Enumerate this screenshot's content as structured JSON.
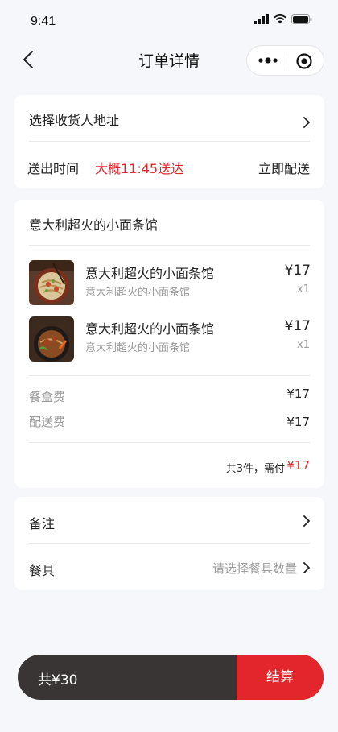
{
  "status_bar": {
    "time": "9:41"
  },
  "nav": {
    "title": "订单详情"
  },
  "address": {
    "select_label": "选择收货人地址",
    "time_label": "送出时间",
    "time_value": "大概11:45送达",
    "delivery_mode": "立即配送"
  },
  "order": {
    "store_name": "意大利超火的小面条馆",
    "items": [
      {
        "name": "意大利超火的小面条馆",
        "desc": "意大利超火的小面条馆",
        "price": "¥17",
        "qty": "x1"
      },
      {
        "name": "意大利超火的小面条馆",
        "desc": "意大利超火的小面条馆",
        "price": "¥17",
        "qty": "x1"
      }
    ],
    "fees": [
      {
        "label": "餐盒费",
        "value": "¥17"
      },
      {
        "label": "配送费",
        "value": "¥17"
      }
    ],
    "summary_label": "共3件，需付",
    "summary_value": "¥17"
  },
  "extras": {
    "remark_label": "备注",
    "utensil_label": "餐具",
    "utensil_placeholder": "请选择餐具数量"
  },
  "checkout": {
    "total": "共¥30",
    "pay_label": "结算"
  },
  "colors": {
    "accent": "#e3262b",
    "checkout_bg": "#3a3535",
    "muted": "#999999"
  }
}
